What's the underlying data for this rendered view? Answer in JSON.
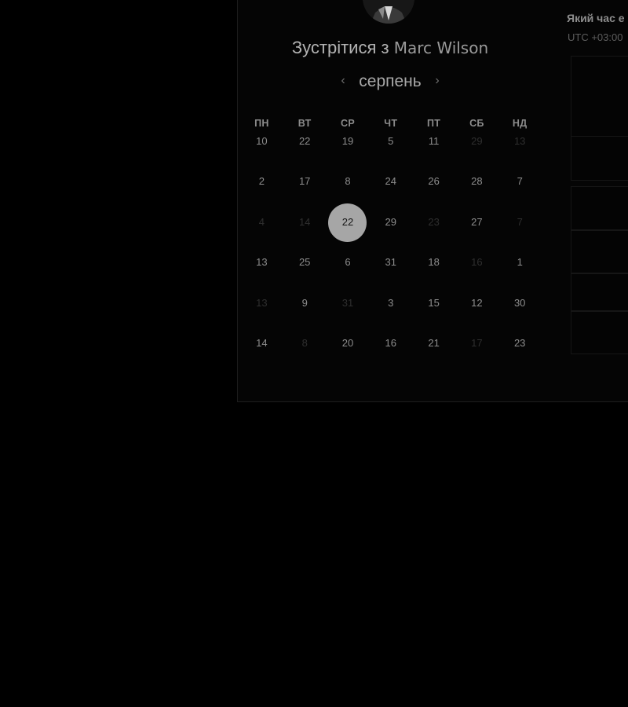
{
  "scheduler": {
    "title_prefix": "Зустрітися з",
    "host_name": "Marc Wilson",
    "month": "серпень",
    "prev_icon": "chevron-left-icon",
    "next_icon": "chevron-right-icon",
    "weekdays": [
      "ПН",
      "ВТ",
      "СР",
      "ЧТ",
      "ПТ",
      "СБ",
      "НД"
    ],
    "weeks": [
      [
        {
          "d": "10",
          "dim": false
        },
        {
          "d": "22",
          "dim": false
        },
        {
          "d": "19",
          "dim": false
        },
        {
          "d": "5",
          "dim": false
        },
        {
          "d": "11",
          "dim": false
        },
        {
          "d": "29",
          "dim": true
        },
        {
          "d": "13",
          "dim": true
        }
      ],
      [
        {
          "d": "2",
          "dim": false
        },
        {
          "d": "17",
          "dim": false
        },
        {
          "d": "8",
          "dim": false
        },
        {
          "d": "24",
          "dim": false
        },
        {
          "d": "26",
          "dim": false
        },
        {
          "d": "28",
          "dim": false
        },
        {
          "d": "7",
          "dim": false
        }
      ],
      [
        {
          "d": "4",
          "dim": true
        },
        {
          "d": "14",
          "dim": true
        },
        {
          "d": "22",
          "dim": false,
          "selected": true
        },
        {
          "d": "29",
          "dim": false
        },
        {
          "d": "23",
          "dim": true
        },
        {
          "d": "27",
          "dim": false
        },
        {
          "d": "7",
          "dim": true
        }
      ],
      [
        {
          "d": "13",
          "dim": false
        },
        {
          "d": "25",
          "dim": false
        },
        {
          "d": "6",
          "dim": false
        },
        {
          "d": "31",
          "dim": false
        },
        {
          "d": "18",
          "dim": false
        },
        {
          "d": "16",
          "dim": true
        },
        {
          "d": "1",
          "dim": false
        }
      ],
      [
        {
          "d": "13",
          "dim": true
        },
        {
          "d": "9",
          "dim": false
        },
        {
          "d": "31",
          "dim": true
        },
        {
          "d": "3",
          "dim": false
        },
        {
          "d": "15",
          "dim": false
        },
        {
          "d": "12",
          "dim": false
        },
        {
          "d": "30",
          "dim": false
        }
      ],
      [
        {
          "d": "14",
          "dim": false
        },
        {
          "d": "8",
          "dim": true
        },
        {
          "d": "20",
          "dim": false
        },
        {
          "d": "16",
          "dim": false
        },
        {
          "d": "21",
          "dim": false
        },
        {
          "d": "17",
          "dim": true
        },
        {
          "d": "23",
          "dim": false
        }
      ]
    ]
  },
  "side_panel": {
    "title": "Який час е",
    "timezone": "UTC +03:00"
  },
  "colors": {
    "background": "#000000",
    "selected_day": "#a6a6a6",
    "text": "#8e8e8e",
    "dim_text": "#2f2f2f"
  }
}
